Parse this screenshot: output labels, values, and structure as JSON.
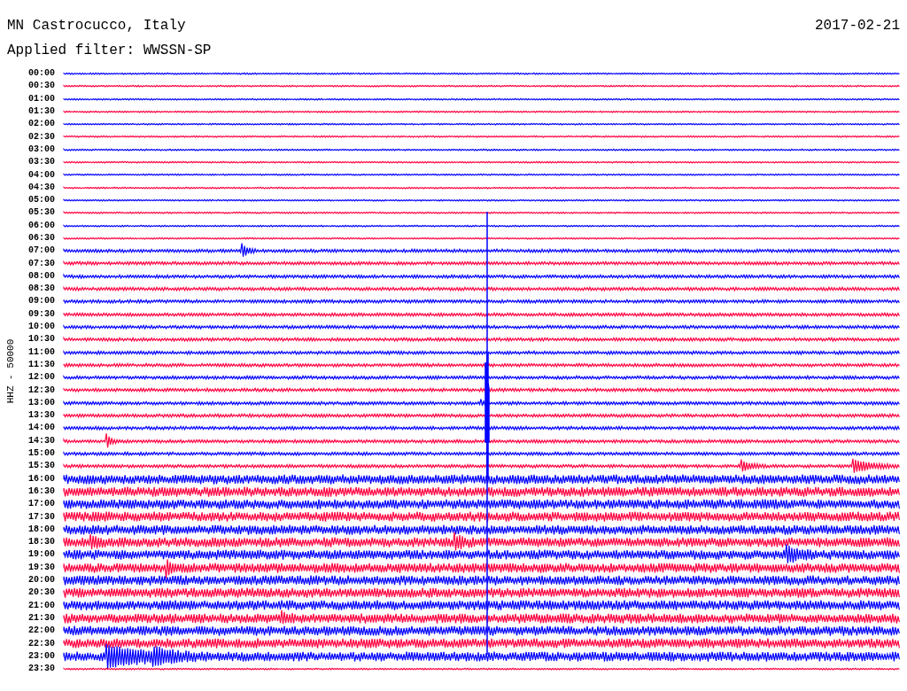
{
  "header": {
    "title": "MN Castrocucco, Italy",
    "date": "2017-02-21",
    "filter": "Applied filter: WWSSN-SP"
  },
  "plot": {
    "axis_label": "HHZ - 50000",
    "rows": [
      {
        "time": "00:00",
        "color": "#0000ff",
        "kind": "quiet"
      },
      {
        "time": "00:30",
        "color": "#ff0040",
        "kind": "quiet"
      },
      {
        "time": "01:00",
        "color": "#0000ff",
        "kind": "quiet"
      },
      {
        "time": "01:30",
        "color": "#ff0040",
        "kind": "quiet"
      },
      {
        "time": "02:00",
        "color": "#0000ff",
        "kind": "quiet"
      },
      {
        "time": "02:30",
        "color": "#ff0040",
        "kind": "quiet"
      },
      {
        "time": "03:00",
        "color": "#0000ff",
        "kind": "quiet"
      },
      {
        "time": "03:30",
        "color": "#ff0040",
        "kind": "quiet"
      },
      {
        "time": "04:00",
        "color": "#0000ff",
        "kind": "quiet"
      },
      {
        "time": "04:30",
        "color": "#ff0040",
        "kind": "quiet"
      },
      {
        "time": "05:00",
        "color": "#0000ff",
        "kind": "quiet"
      },
      {
        "time": "05:30",
        "color": "#ff0040",
        "kind": "quiet"
      },
      {
        "time": "06:00",
        "color": "#0000ff",
        "kind": "quiet"
      },
      {
        "time": "06:30",
        "color": "#ff0040",
        "kind": "quiet"
      },
      {
        "time": "07:00",
        "color": "#0000ff",
        "kind": "noisy"
      },
      {
        "time": "07:30",
        "color": "#ff0040",
        "kind": "noisy"
      },
      {
        "time": "08:00",
        "color": "#0000ff",
        "kind": "noisy"
      },
      {
        "time": "08:30",
        "color": "#ff0040",
        "kind": "noisy"
      },
      {
        "time": "09:00",
        "color": "#0000ff",
        "kind": "noisy"
      },
      {
        "time": "09:30",
        "color": "#ff0040",
        "kind": "noisy"
      },
      {
        "time": "10:00",
        "color": "#0000ff",
        "kind": "noisy"
      },
      {
        "time": "10:30",
        "color": "#ff0040",
        "kind": "noisy"
      },
      {
        "time": "11:00",
        "color": "#0000ff",
        "kind": "noisy"
      },
      {
        "time": "11:30",
        "color": "#ff0040",
        "kind": "noisy"
      },
      {
        "time": "12:00",
        "color": "#0000ff",
        "kind": "noisy"
      },
      {
        "time": "12:30",
        "color": "#ff0040",
        "kind": "noisy"
      },
      {
        "time": "13:00",
        "color": "#0000ff",
        "kind": "noisy"
      },
      {
        "time": "13:30",
        "color": "#ff0040",
        "kind": "noisy"
      },
      {
        "time": "14:00",
        "color": "#0000ff",
        "kind": "noisy"
      },
      {
        "time": "14:30",
        "color": "#ff0040",
        "kind": "noisy"
      },
      {
        "time": "15:00",
        "color": "#0000ff",
        "kind": "noisy"
      },
      {
        "time": "15:30",
        "color": "#ff0040",
        "kind": "noisy"
      },
      {
        "time": "16:00",
        "color": "#0000ff",
        "kind": "heavy"
      },
      {
        "time": "16:30",
        "color": "#ff0040",
        "kind": "heavy"
      },
      {
        "time": "17:00",
        "color": "#0000ff",
        "kind": "heavy"
      },
      {
        "time": "17:30",
        "color": "#ff0040",
        "kind": "heavy"
      },
      {
        "time": "18:00",
        "color": "#0000ff",
        "kind": "heavy"
      },
      {
        "time": "18:30",
        "color": "#ff0040",
        "kind": "heavy"
      },
      {
        "time": "19:00",
        "color": "#0000ff",
        "kind": "heavy"
      },
      {
        "time": "19:30",
        "color": "#ff0040",
        "kind": "heavy"
      },
      {
        "time": "20:00",
        "color": "#0000ff",
        "kind": "heavy"
      },
      {
        "time": "20:30",
        "color": "#ff0040",
        "kind": "heavy"
      },
      {
        "time": "21:00",
        "color": "#0000ff",
        "kind": "heavy"
      },
      {
        "time": "21:30",
        "color": "#ff0040",
        "kind": "heavy"
      },
      {
        "time": "22:00",
        "color": "#0000ff",
        "kind": "heavy"
      },
      {
        "time": "22:30",
        "color": "#ff0040",
        "kind": "heavy"
      },
      {
        "time": "23:00",
        "color": "#0000ff",
        "kind": "heavy"
      },
      {
        "time": "23:30",
        "color": "#ff0040",
        "kind": "quiet"
      }
    ]
  }
}
